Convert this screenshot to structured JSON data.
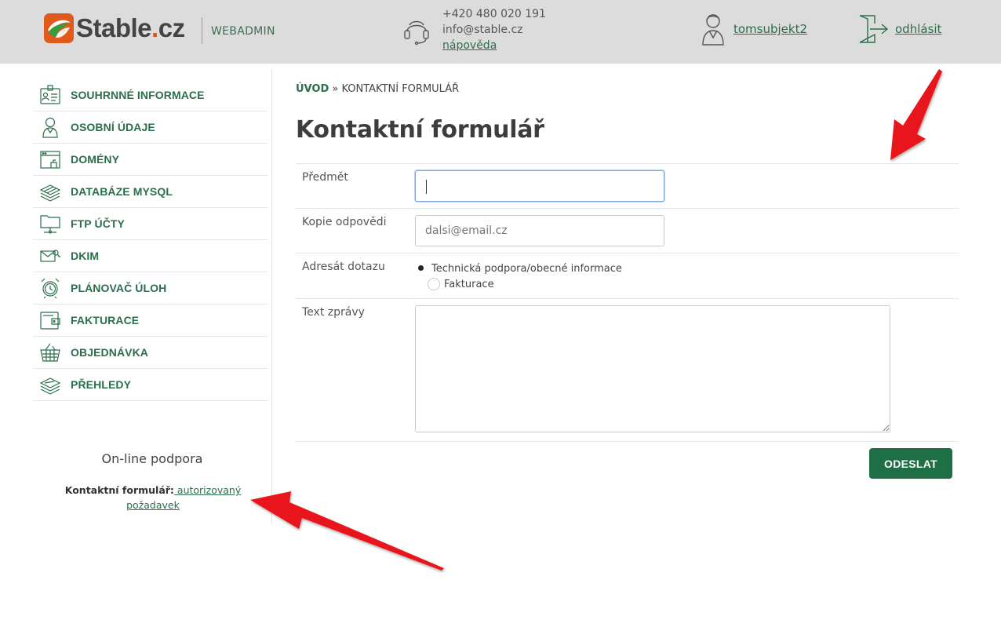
{
  "header": {
    "logo": {
      "name": "Stable",
      "dot": ".",
      "tld": "cz"
    },
    "subtitle": "WEBADMIN",
    "contact": {
      "phone": "+420 480 020 191",
      "email": "info@stable.cz",
      "help_link": "nápověda"
    },
    "user_link": "tomsubjekt2",
    "logout_link": "odhlásit"
  },
  "sidebar": {
    "items": [
      {
        "label": "SOUHRNNÉ INFORMACE",
        "icon": "id-card-icon"
      },
      {
        "label": "OSOBNÍ ÚDAJE",
        "icon": "person-icon"
      },
      {
        "label": "DOMÉNY",
        "icon": "browser-window-icon"
      },
      {
        "label": "DATABÁZE MYSQL",
        "icon": "database-stack-icon"
      },
      {
        "label": "FTP ÚČTY",
        "icon": "folder-network-icon"
      },
      {
        "label": "DKIM",
        "icon": "envelope-key-icon"
      },
      {
        "label": "PLÁNOVAČ ÚLOH",
        "icon": "alarm-clock-icon"
      },
      {
        "label": "FAKTURACE",
        "icon": "wallet-icon"
      },
      {
        "label": "OBJEDNÁVKA",
        "icon": "basket-icon"
      },
      {
        "label": "PŘEHLEDY",
        "icon": "stacked-layers-icon"
      }
    ],
    "support": {
      "title": "On-line podpora",
      "label": "Kontaktní formulář:",
      "link": " autorizovaný požadavek"
    }
  },
  "breadcrumb": {
    "home": "ÚVOD",
    "separator": " » ",
    "current": "KONTAKTNÍ FORMULÁŘ"
  },
  "page_title": "Kontaktní formulář",
  "form": {
    "subject_label": "Předmět",
    "subject_value": "",
    "copy_label": "Kopie odpovědi",
    "copy_placeholder": "dalsi@email.cz",
    "recipient_label": "Adresát dotazu",
    "recipient_options": [
      {
        "label": "Technická podpora/obecné informace",
        "selected": true
      },
      {
        "label": "Fakturace",
        "selected": false
      }
    ],
    "message_label": "Text zprávy",
    "submit_label": "ODESLAT"
  },
  "colors": {
    "brand_green": "#1e6e46",
    "link_green": "#2b6e4b",
    "header_bg": "#dcdcdc",
    "arrow_red": "#e8191a"
  }
}
